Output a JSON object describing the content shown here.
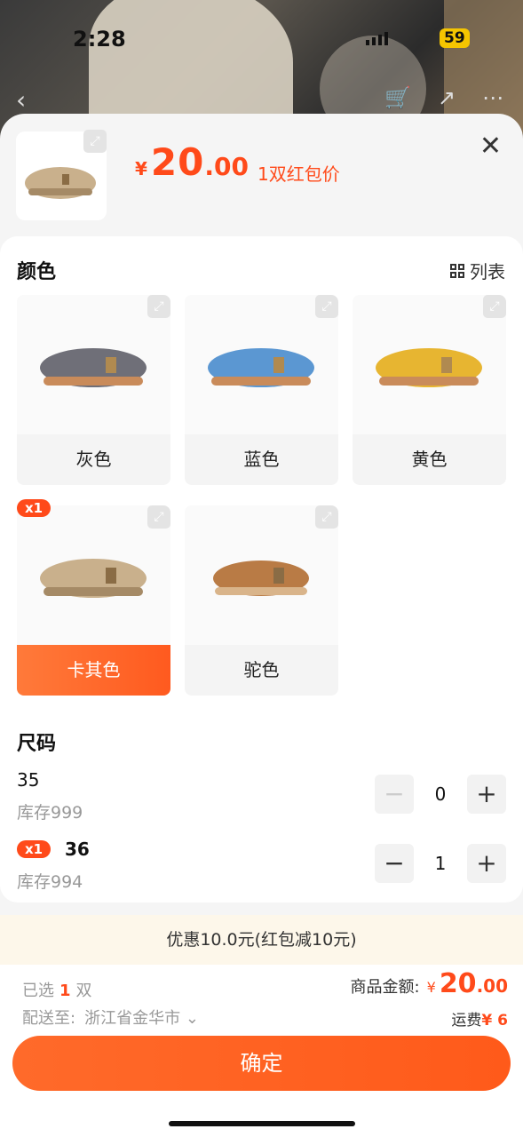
{
  "status_bar": {
    "time": "2:28",
    "battery": "59"
  },
  "header": {
    "price_symbol": "¥",
    "price_int": "20",
    "price_dec": ".00",
    "price_note": "1双红包价"
  },
  "color_section": {
    "title": "颜色",
    "list_toggle_label": "列表",
    "options": [
      {
        "label": "灰色",
        "color": "#6f6f78"
      },
      {
        "label": "蓝色",
        "color": "#5b97d2"
      },
      {
        "label": "黄色",
        "color": "#e7b531"
      },
      {
        "label": "卡其色",
        "color": "#c9b08c",
        "badge": "x1",
        "selected": true
      },
      {
        "label": "驼色",
        "color": "#b97b45"
      }
    ]
  },
  "size_section": {
    "title": "尺码",
    "sizes": [
      {
        "size": "35",
        "stock": "库存999",
        "qty": "0"
      },
      {
        "size": "36",
        "stock": "库存994",
        "qty": "1",
        "badge": "x1"
      }
    ]
  },
  "promo": "优惠10.0元(红包减10元)",
  "footer": {
    "selected_prefix": "已选",
    "selected_count": "1",
    "selected_unit": "双",
    "ship_label": "配送至:",
    "ship_address": "浙江省金华市",
    "amount_label": "商品金额:",
    "amount_symbol": "¥",
    "amount_int": "20",
    "amount_dec": ".00",
    "freight_label": "运费",
    "freight_value": "¥ 6",
    "confirm_label": "确定"
  },
  "colors": {
    "accent": "#ff4a1a"
  }
}
